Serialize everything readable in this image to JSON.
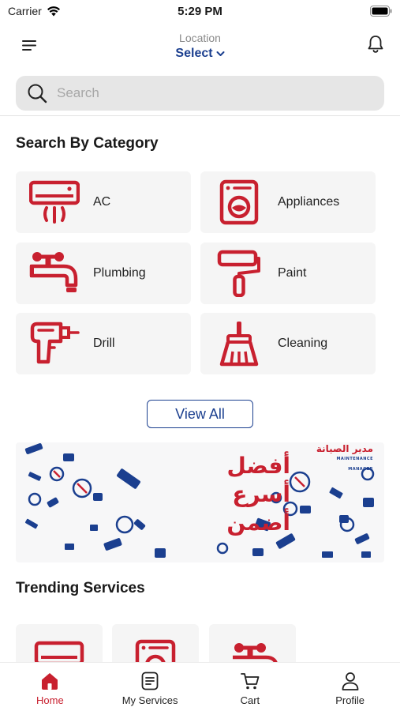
{
  "status_bar": {
    "carrier": "Carrier",
    "time": "5:29 PM"
  },
  "header": {
    "location_label": "Location",
    "location_value": "Select",
    "icons": {
      "menu": "menu-icon",
      "location_chevron": "chevron-down-icon",
      "notifications": "bell-icon"
    }
  },
  "search": {
    "placeholder": "Search",
    "icon": "search-icon"
  },
  "categories_section": {
    "title": "Search By Category",
    "items": [
      {
        "label": "AC",
        "icon": "air-conditioner-icon"
      },
      {
        "label": "Appliances",
        "icon": "washing-machine-icon"
      },
      {
        "label": "Plumbing",
        "icon": "faucet-icon"
      },
      {
        "label": "Paint",
        "icon": "paint-roller-icon"
      },
      {
        "label": "Drill",
        "icon": "drill-icon"
      },
      {
        "label": "Cleaning",
        "icon": "broom-icon"
      }
    ],
    "view_all_label": "View All"
  },
  "banner": {
    "headline_lines": [
      "أفضل",
      "أسرع",
      "أضمن"
    ],
    "logo_text": "مدير الصيانة",
    "logo_subtext": "MAINTENANCE MANAGER"
  },
  "trending": {
    "title": "Trending Services",
    "cards": [
      {
        "icon": "air-conditioner-icon"
      },
      {
        "icon": "washing-machine-icon"
      },
      {
        "icon": "faucet-icon"
      }
    ]
  },
  "tabbar": {
    "items": [
      {
        "label": "Home",
        "icon": "home-icon",
        "active": true
      },
      {
        "label": "My Services",
        "icon": "services-list-icon",
        "active": false
      },
      {
        "label": "Cart",
        "icon": "cart-icon",
        "active": false
      },
      {
        "label": "Profile",
        "icon": "profile-icon",
        "active": false
      }
    ]
  },
  "colors": {
    "accent_red": "#c8202f",
    "accent_blue": "#1b3f8f",
    "card_bg": "#f5f5f5"
  }
}
